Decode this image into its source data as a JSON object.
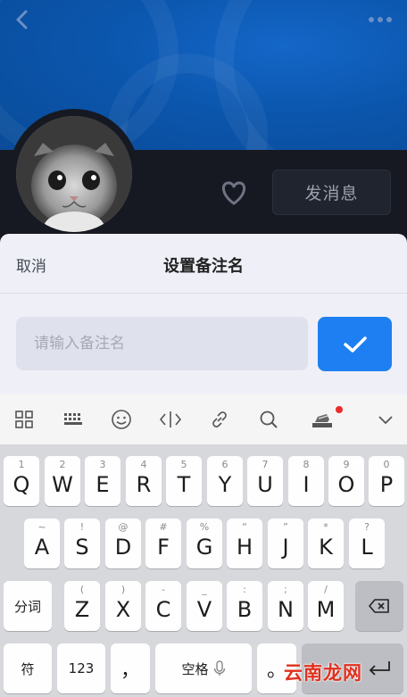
{
  "header": {
    "back_icon": "chevron-left-icon",
    "more_icon": "more-dots-icon"
  },
  "profile": {
    "avatar_desc": "avatar",
    "favorite_icon": "heart-icon",
    "message_button": "发消息"
  },
  "remark_sheet": {
    "cancel_label": "取消",
    "title": "设置备注名",
    "input_placeholder": "请输入备注名",
    "input_value": "",
    "confirm_icon": "check-icon"
  },
  "keyboard_toolbar": {
    "tools": [
      "grid-icon",
      "keypad-icon",
      "emoji-icon",
      "cursor-icon",
      "link-icon",
      "search-icon",
      "stamp-icon",
      "chevron-down-icon"
    ]
  },
  "keyboard": {
    "row1": [
      {
        "main": "Q",
        "sub": "1"
      },
      {
        "main": "W",
        "sub": "2"
      },
      {
        "main": "E",
        "sub": "3"
      },
      {
        "main": "R",
        "sub": "4"
      },
      {
        "main": "T",
        "sub": "5"
      },
      {
        "main": "Y",
        "sub": "6"
      },
      {
        "main": "U",
        "sub": "7"
      },
      {
        "main": "I",
        "sub": "8"
      },
      {
        "main": "O",
        "sub": "9"
      },
      {
        "main": "P",
        "sub": "0"
      }
    ],
    "row2": [
      {
        "main": "A",
        "sub": "~"
      },
      {
        "main": "S",
        "sub": "!"
      },
      {
        "main": "D",
        "sub": "@"
      },
      {
        "main": "F",
        "sub": "#"
      },
      {
        "main": "G",
        "sub": "%"
      },
      {
        "main": "H",
        "sub": "“"
      },
      {
        "main": "J",
        "sub": "”"
      },
      {
        "main": "K",
        "sub": "*"
      },
      {
        "main": "L",
        "sub": "?"
      }
    ],
    "row3": [
      {
        "main": "Z",
        "sub": "("
      },
      {
        "main": "X",
        "sub": ")"
      },
      {
        "main": "C",
        "sub": "-"
      },
      {
        "main": "V",
        "sub": "_"
      },
      {
        "main": "B",
        "sub": ":"
      },
      {
        "main": "N",
        "sub": ";"
      },
      {
        "main": "M",
        "sub": "/"
      }
    ],
    "segment_label": "分词",
    "symbol_label": "符",
    "number_label": "123",
    "comma_label": "，",
    "space_label": "空格",
    "period_label": "。",
    "backspace_icon": "backspace-icon",
    "enter_icon": "enter-icon"
  },
  "watermark": {
    "text": "云南龙网"
  }
}
